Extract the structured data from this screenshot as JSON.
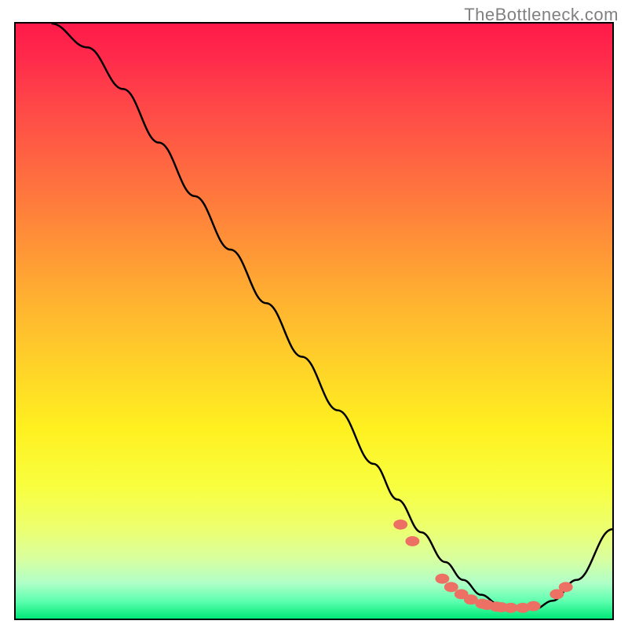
{
  "watermark": "TheBottleneck.com",
  "chart_data": {
    "type": "line",
    "title": "",
    "xlabel": "",
    "ylabel": "",
    "xlim": [
      0,
      100
    ],
    "ylim": [
      0,
      100
    ],
    "grid": false,
    "legend": false,
    "series": [
      {
        "name": "curve",
        "x": [
          6,
          12,
          18,
          24,
          30,
          36,
          42,
          48,
          54,
          60,
          64,
          68,
          72,
          75,
          78,
          81,
          84,
          87,
          90,
          94,
          100
        ],
        "y": [
          100,
          96,
          89,
          80,
          71,
          62,
          53,
          44,
          35,
          26,
          20,
          14.5,
          9.5,
          6.5,
          4,
          2.4,
          1.6,
          1.6,
          3,
          6.5,
          15
        ]
      }
    ],
    "markers": [
      {
        "x": 64.5,
        "y": 15.8
      },
      {
        "x": 66.5,
        "y": 13.0
      },
      {
        "x": 71.5,
        "y": 6.7
      },
      {
        "x": 73.0,
        "y": 5.3
      },
      {
        "x": 74.7,
        "y": 4.1
      },
      {
        "x": 76.3,
        "y": 3.2
      },
      {
        "x": 78.2,
        "y": 2.5
      },
      {
        "x": 79.0,
        "y": 2.3
      },
      {
        "x": 80.6,
        "y": 2.0
      },
      {
        "x": 81.4,
        "y": 1.9
      },
      {
        "x": 83.0,
        "y": 1.8
      },
      {
        "x": 85.0,
        "y": 1.8
      },
      {
        "x": 86.8,
        "y": 2.1
      },
      {
        "x": 90.7,
        "y": 4.1
      },
      {
        "x": 92.2,
        "y": 5.3
      }
    ],
    "colors": {
      "curve": "#000000",
      "marker_fill": "#ec7063",
      "marker_stroke": "#e74c3c"
    }
  }
}
